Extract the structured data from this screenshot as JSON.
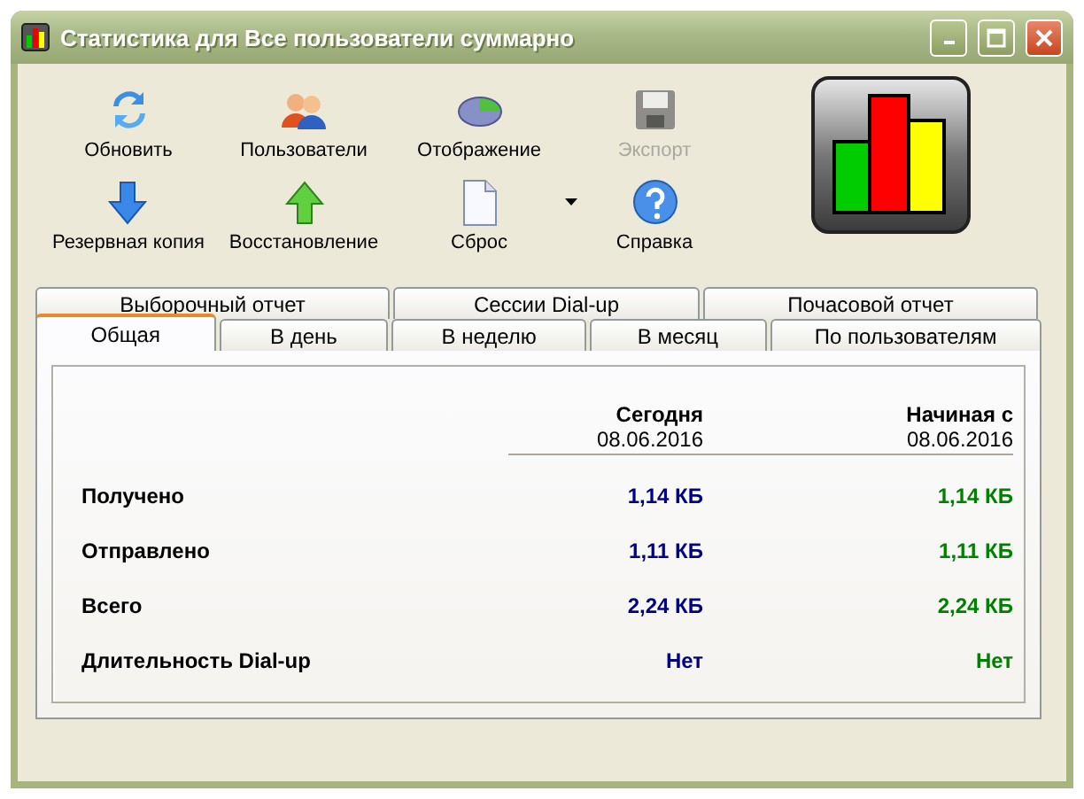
{
  "window": {
    "title": "Статистика для Все  пользователи суммарно"
  },
  "toolbar": [
    {
      "label": "Обновить",
      "disabled": false,
      "dropdown": false
    },
    {
      "label": "Пользователи",
      "disabled": false,
      "dropdown": false
    },
    {
      "label": "Отображение",
      "disabled": false,
      "dropdown": false
    },
    {
      "label": "Экспорт",
      "disabled": true,
      "dropdown": false
    },
    {
      "label": "Резервная копия",
      "disabled": false,
      "dropdown": false
    },
    {
      "label": "Восстановление",
      "disabled": false,
      "dropdown": false
    },
    {
      "label": "Сброс",
      "disabled": false,
      "dropdown": true
    },
    {
      "label": "Справка",
      "disabled": false,
      "dropdown": false
    }
  ],
  "tab_rows": [
    [
      {
        "label": "Выборочный отчет",
        "selected": false
      },
      {
        "label": "Сессии Dial-up",
        "selected": false
      },
      {
        "label": "Почасовой отчет",
        "selected": false
      }
    ],
    [
      {
        "label": "Общая",
        "selected": true
      },
      {
        "label": "В день",
        "selected": false
      },
      {
        "label": "В неделю",
        "selected": false
      },
      {
        "label": "В месяц",
        "selected": false
      },
      {
        "label": "По пользователям",
        "selected": false
      }
    ]
  ],
  "columns": [
    {
      "header": "Сегодня",
      "date": "08.06.2016",
      "color": "#000080"
    },
    {
      "header": "Начиная с",
      "date": "08.06.2016",
      "color": "#008000"
    }
  ],
  "rows": [
    {
      "label": "Получено",
      "values": [
        "1,14 КБ",
        "1,14 КБ"
      ]
    },
    {
      "label": "Отправлено",
      "values": [
        "1,11 КБ",
        "1,11 КБ"
      ]
    },
    {
      "label": "Всего",
      "values": [
        "2,24 КБ",
        "2,24 КБ"
      ]
    },
    {
      "label": "Длительность Dial-up",
      "values": [
        "Нет",
        "Нет"
      ]
    }
  ]
}
